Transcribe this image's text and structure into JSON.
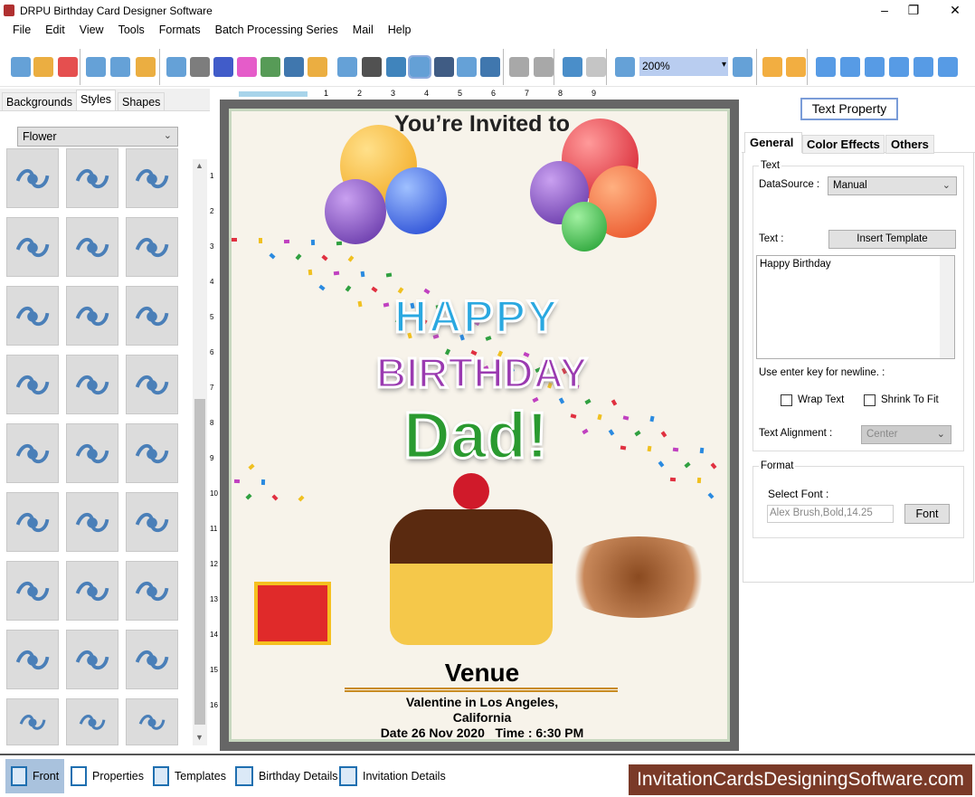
{
  "window": {
    "title": "DRPU Birthday Card Designer Software",
    "minimize": "–",
    "maximize": "❐",
    "close": "✕"
  },
  "menu": [
    "File",
    "Edit",
    "View",
    "Tools",
    "Formats",
    "Batch Processing Series",
    "Mail",
    "Help"
  ],
  "toolbar": {
    "zoom_value": "200%",
    "icons": [
      "new-icon",
      "open-icon",
      "close-file-icon",
      "save-icon",
      "save-as-icon",
      "export-icon",
      "properties-icon",
      "print-icon",
      "copy-pages-icon",
      "gift-icon",
      "insert-image-icon",
      "signature-icon",
      "shapes-icon",
      "watermark-icon",
      "barcode-icon",
      "text-icon",
      "text-property-icon",
      "word-art-icon",
      "mail-icon",
      "line-icon",
      "database-add-icon",
      "database-icon",
      "undo-icon",
      "redo-icon",
      "zoom-in-icon",
      "zoom-out-icon",
      "lock-icon",
      "unlock-icon",
      "arrow-left-icon",
      "flip-icon",
      "arrow-right-icon",
      "arrow-up-icon",
      "align-icon",
      "arrow-down-icon"
    ]
  },
  "left_panel": {
    "tabs": [
      "Backgrounds",
      "Styles",
      "Shapes"
    ],
    "active_tab": "Styles",
    "category": "Flower",
    "thumbnail_count": 27
  },
  "ruler": {
    "h": [
      "1",
      "2",
      "3",
      "4",
      "5",
      "6",
      "7",
      "8",
      "9"
    ],
    "v": [
      "1",
      "2",
      "3",
      "4",
      "5",
      "6",
      "7",
      "8",
      "9",
      "10",
      "11",
      "12",
      "13",
      "14",
      "15",
      "16"
    ]
  },
  "card": {
    "heading": "You’re Invited to",
    "happy": "HAPPY",
    "birthday": "BIRTHDAY",
    "name": "Dad!",
    "venue_title": "Venue",
    "venue_line1": "Valentine in Los Angeles,",
    "venue_line2": "California",
    "date_line": "Date 26 Nov 2020   Time : 6:30 PM"
  },
  "right_panel": {
    "header_button": "Text Property",
    "tabs": [
      "General",
      "Color Effects",
      "Others"
    ],
    "active_tab": "General",
    "text_group": "Text",
    "datasource_label": "DataSource :",
    "datasource_value": "Manual",
    "text_label": "Text :",
    "insert_template": "Insert Template",
    "text_value": "Happy Birthday",
    "hint": "Use enter key for newline. :",
    "wrap_text": "Wrap Text",
    "wrap_checked": false,
    "shrink_to_fit": "Shrink To Fit",
    "shrink_checked": false,
    "alignment_label": "Text Alignment :",
    "alignment_value": "Center",
    "format_group": "Format",
    "select_font_label": "Select Font :",
    "font_value": "Alex Brush,Bold,14.25",
    "font_button": "Font"
  },
  "bottom_tabs": [
    "Front",
    "Properties",
    "Templates",
    "Birthday Details",
    "Invitation Details"
  ],
  "active_bottom": "Front",
  "brand": "InvitationCardsDesigningSoftware.com",
  "colors": {
    "accent": "#1f6fb0",
    "brand_bg": "#7a3a28",
    "selected_tab": "#a9c2dd",
    "card_frame": "#666666"
  }
}
